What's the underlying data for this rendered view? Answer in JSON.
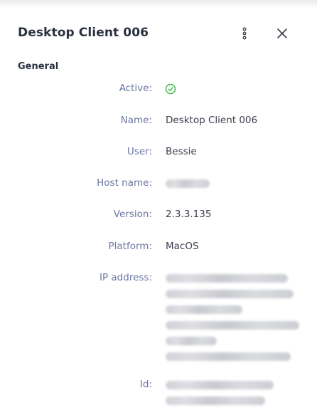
{
  "header": {
    "title": "Desktop Client 006"
  },
  "section": {
    "title": "General"
  },
  "fields": {
    "active": {
      "label": "Active:"
    },
    "name": {
      "label": "Name:",
      "value": "Desktop Client 006"
    },
    "user": {
      "label": "User:",
      "value": "Bessie"
    },
    "host_name": {
      "label": "Host name:"
    },
    "version": {
      "label": "Version:",
      "value": "2.3.3.135"
    },
    "platform": {
      "label": "Platform:",
      "value": "MacOS"
    },
    "ip_address": {
      "label": "IP address:"
    },
    "id": {
      "label": "Id:"
    }
  },
  "colors": {
    "active_check": "#3db54a",
    "label": "#6b77a1",
    "value": "#3a3f4e",
    "title": "#2b3040"
  },
  "icons": {
    "menu": "kebab-menu-icon",
    "close": "close-icon",
    "active": "check-circle-icon"
  }
}
